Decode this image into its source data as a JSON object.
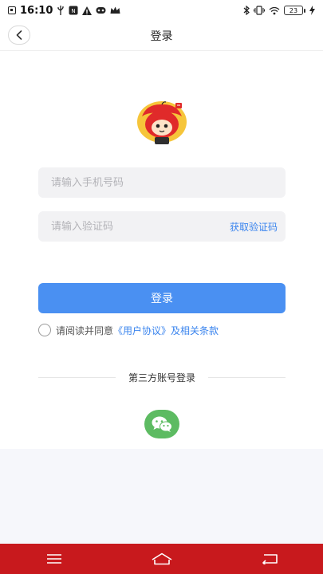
{
  "status_bar": {
    "time": "16:10",
    "battery_level": "23",
    "icons": [
      "screenshot-icon",
      "usb-icon",
      "nfc-icon",
      "warning-icon",
      "game-icon",
      "crown-icon",
      "bluetooth-icon",
      "vibrate-icon",
      "wifi-icon",
      "battery-icon",
      "charging-icon"
    ]
  },
  "header": {
    "title": "登录",
    "back_icon": "chevron-left-icon"
  },
  "form": {
    "phone_placeholder": "请输入手机号码",
    "code_placeholder": "请输入验证码",
    "get_code_label": "获取验证码",
    "login_label": "登录"
  },
  "agreement": {
    "prefix": "请阅读并同意",
    "link": "《用户协议》",
    "suffix": "及相关条款",
    "checked": false
  },
  "third_party": {
    "title": "第三方账号登录",
    "wechat_icon": "wechat-icon"
  },
  "system_nav": {
    "buttons": [
      "menu-icon",
      "home-icon",
      "back-icon"
    ]
  },
  "colors": {
    "accent": "#4a90f2",
    "link": "#3a84ee",
    "wechat": "#5dbb62",
    "system_nav": "#c8191d",
    "logo_red": "#e02a2a",
    "logo_yellow": "#f6c53a"
  }
}
